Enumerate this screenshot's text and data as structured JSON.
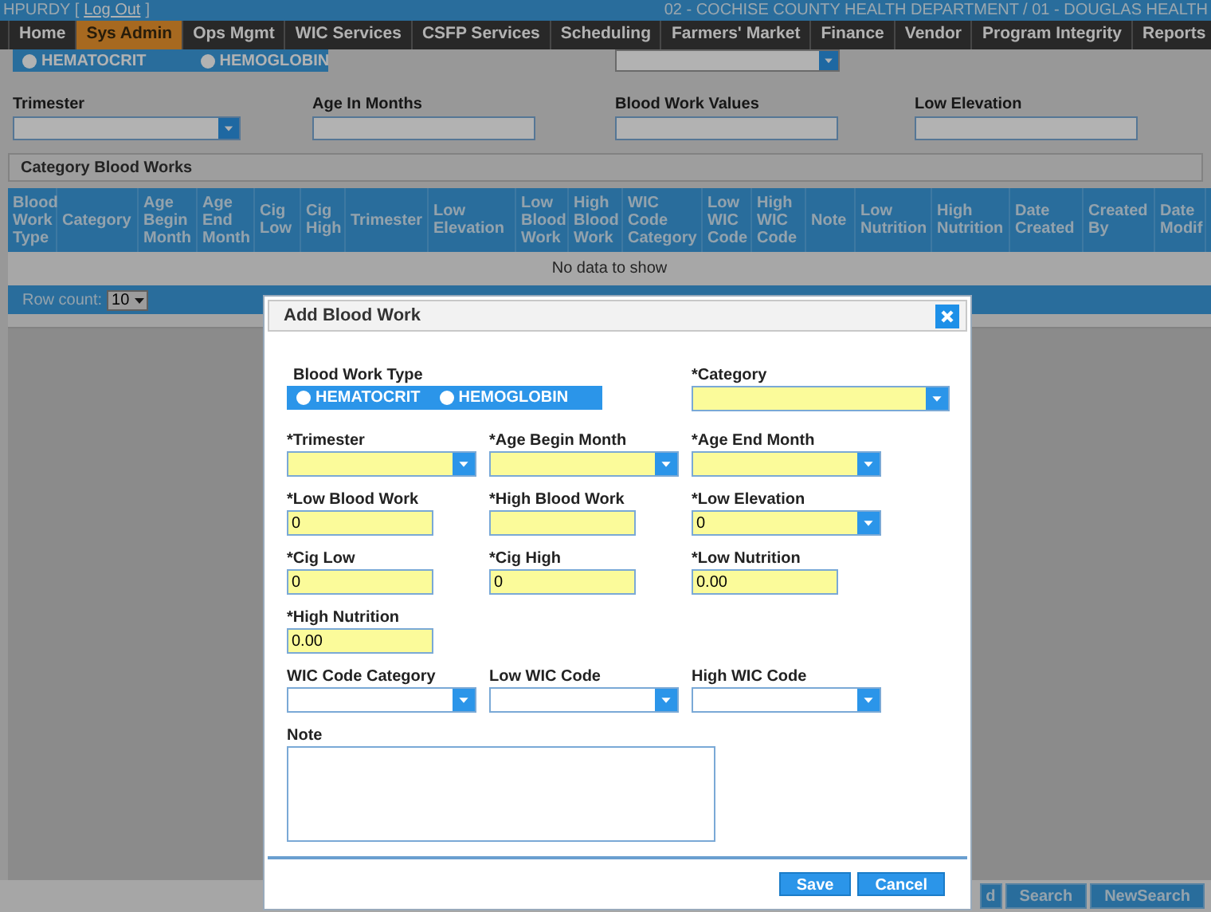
{
  "top_bar": {
    "user": "HPURDY [",
    "logout_link": "Log Out",
    "user_end": "]",
    "agency": "02 - COCHISE COUNTY HEALTH DEPARTMENT / 01 - DOUGLAS HEALTH"
  },
  "nav": [
    {
      "label": "Home",
      "selected": false
    },
    {
      "label": "Sys Admin",
      "selected": true
    },
    {
      "label": "Ops Mgmt",
      "selected": false
    },
    {
      "label": "WIC Services",
      "selected": false
    },
    {
      "label": "CSFP Services",
      "selected": false
    },
    {
      "label": "Scheduling",
      "selected": false
    },
    {
      "label": "Farmers' Market",
      "selected": false
    },
    {
      "label": "Finance",
      "selected": false
    },
    {
      "label": "Vendor",
      "selected": false
    },
    {
      "label": "Program Integrity",
      "selected": false
    },
    {
      "label": "Reports",
      "selected": false
    }
  ],
  "type_filter": [
    {
      "label": "HEMATOCRIT",
      "selected": false
    },
    {
      "label": "HEMOGLOBIN",
      "selected": false
    }
  ],
  "filters": [
    {
      "label": "Trimester",
      "kind": "select"
    },
    {
      "label": "Age In Months",
      "kind": "text"
    },
    {
      "label": "Blood Work Values",
      "kind": "text"
    },
    {
      "label": "Low Elevation",
      "kind": "text"
    }
  ],
  "panel": {
    "title": "Category Blood Works",
    "columns": [
      "Blood Work Type",
      "Category",
      "Age Begin Month",
      "Age End Month",
      "Cig Low",
      "Cig High",
      "Trimester",
      "Low Elevation",
      "Low Blood Work",
      "High Blood Work",
      "WIC Code Category",
      "Low WIC Code",
      "High WIC Code",
      "Note",
      "Low Nutrition",
      "High Nutrition",
      "Date Created",
      "Created By",
      "Date Modif"
    ],
    "empty_text": "No data to show",
    "row_count_label": "Row count:",
    "row_count": "10"
  },
  "bottom_buttons": [
    "d",
    "Search",
    "NewSearch"
  ],
  "dialog": {
    "title": "Add Blood Work",
    "rows": [
      [
        {
          "kind": "radio",
          "label": "Blood Work Type",
          "options": [
            {
              "label": "HEMATOCRIT",
              "selected": false
            },
            {
              "label": "HEMOGLOBIN",
              "selected": false
            }
          ]
        },
        {
          "kind": "spacer"
        },
        {
          "kind": "select",
          "label": "*Category",
          "required": true
        }
      ],
      [
        {
          "kind": "select",
          "label": "*Trimester",
          "required": true
        },
        {
          "kind": "select",
          "label": "*Age Begin Month",
          "required": true
        },
        {
          "kind": "select",
          "label": "*Age End Month",
          "required": true
        }
      ],
      [
        {
          "kind": "text",
          "label": "*Low Blood Work",
          "required": true,
          "value": "0"
        },
        {
          "kind": "text",
          "label": "*High Blood Work",
          "required": true
        },
        {
          "kind": "select",
          "label": "*Low Elevation",
          "required": true,
          "value": "0"
        }
      ],
      [
        {
          "kind": "text",
          "label": "*Cig Low",
          "required": true,
          "value": "0"
        },
        {
          "kind": "text",
          "label": "*Cig High",
          "required": true,
          "value": "0"
        },
        {
          "kind": "text",
          "label": "*Low Nutrition",
          "required": true,
          "value": "0.00"
        }
      ],
      [
        {
          "kind": "text",
          "label": "*High Nutrition",
          "required": true,
          "value": "0.00"
        }
      ],
      [
        {
          "kind": "select",
          "label": "WIC Code Category",
          "required": false
        },
        {
          "kind": "select",
          "label": "Low WIC Code",
          "required": false
        },
        {
          "kind": "select",
          "label": "High WIC Code",
          "required": false
        }
      ],
      [
        {
          "kind": "textarea",
          "label": "Note",
          "required": false
        }
      ]
    ],
    "buttons": [
      "Save",
      "Cancel"
    ]
  }
}
